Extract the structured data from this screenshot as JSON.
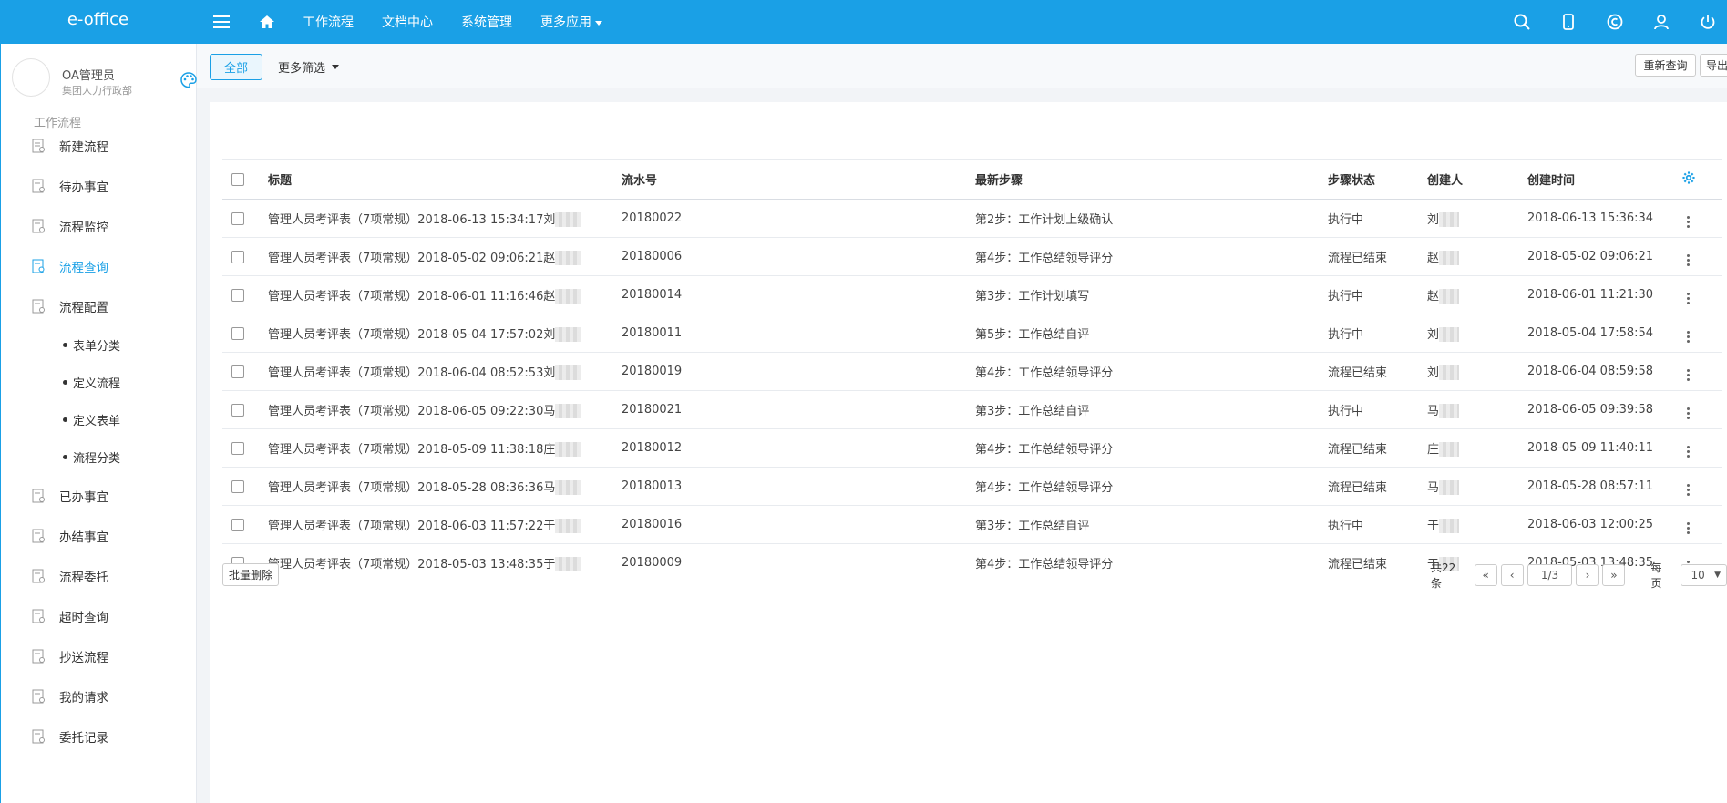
{
  "app": {
    "logo": "e-office"
  },
  "topnav": {
    "items": [
      "工作流程",
      "文档中心",
      "系统管理",
      "更多应用"
    ]
  },
  "user": {
    "name": "OA管理员",
    "dept": "集团人力行政部"
  },
  "sidebar": {
    "section_title": "工作流程",
    "items": [
      "新建流程",
      "待办事宜",
      "流程监控",
      "流程查询",
      "流程配置"
    ],
    "sub_items": [
      "表单分类",
      "定义流程",
      "定义表单",
      "流程分类"
    ],
    "items_after": [
      "已办事宜",
      "办结事宜",
      "流程委托",
      "超时查询",
      "抄送流程",
      "我的请求",
      "委托记录"
    ],
    "active": "流程查询"
  },
  "filter": {
    "all_label": "全部",
    "more_label": "更多筛选",
    "requery_label": "重新查询",
    "export_label": "导出"
  },
  "table": {
    "headers": [
      "标题",
      "流水号",
      "最新步骤",
      "步骤状态",
      "创建人",
      "创建时间"
    ],
    "rows": [
      {
        "title": "管理人员考评表（7项常规）2018-06-13 15:34:17刘",
        "serial": "20180022",
        "step": "第2步：工作计划上级确认",
        "status": "执行中",
        "creator": "刘",
        "time": "2018-06-13 15:36:34"
      },
      {
        "title": "管理人员考评表（7项常规）2018-05-02 09:06:21赵",
        "serial": "20180006",
        "step": "第4步：工作总结领导评分",
        "status": "流程已结束",
        "creator": "赵",
        "time": "2018-05-02 09:06:21"
      },
      {
        "title": "管理人员考评表（7项常规）2018-06-01 11:16:46赵",
        "serial": "20180014",
        "step": "第3步：工作计划填写",
        "status": "执行中",
        "creator": "赵",
        "time": "2018-06-01 11:21:30"
      },
      {
        "title": "管理人员考评表（7项常规）2018-05-04 17:57:02刘",
        "serial": "20180011",
        "step": "第5步：工作总结自评",
        "status": "执行中",
        "creator": "刘",
        "time": "2018-05-04 17:58:54"
      },
      {
        "title": "管理人员考评表（7项常规）2018-06-04 08:52:53刘",
        "serial": "20180019",
        "step": "第4步：工作总结领导评分",
        "status": "流程已结束",
        "creator": "刘",
        "time": "2018-06-04 08:59:58"
      },
      {
        "title": "管理人员考评表（7项常规）2018-06-05 09:22:30马",
        "serial": "20180021",
        "step": "第3步：工作总结自评",
        "status": "执行中",
        "creator": "马",
        "time": "2018-06-05 09:39:58"
      },
      {
        "title": "管理人员考评表（7项常规）2018-05-09 11:38:18庄",
        "serial": "20180012",
        "step": "第4步：工作总结领导评分",
        "status": "流程已结束",
        "creator": "庄",
        "time": "2018-05-09 11:40:11"
      },
      {
        "title": "管理人员考评表（7项常规）2018-05-28 08:36:36马",
        "serial": "20180013",
        "step": "第4步：工作总结领导评分",
        "status": "流程已结束",
        "creator": "马",
        "time": "2018-05-28 08:57:11"
      },
      {
        "title": "管理人员考评表（7项常规）2018-06-03 11:57:22于",
        "serial": "20180016",
        "step": "第3步：工作总结自评",
        "status": "执行中",
        "creator": "于",
        "time": "2018-06-03 12:00:25"
      },
      {
        "title": "管理人员考评表（7项常规）2018-05-03 13:48:35于",
        "serial": "20180009",
        "step": "第4步：工作总结领导评分",
        "status": "流程已结束",
        "creator": "于",
        "time": "2018-05-03 13:48:35"
      }
    ]
  },
  "footer": {
    "batch_delete_label": "批量删除",
    "total_label": "共22条",
    "page_label": "1/3",
    "per_page_label": "每页",
    "per_page_value": "10"
  },
  "colors": {
    "accent": "#1aa0e6"
  }
}
